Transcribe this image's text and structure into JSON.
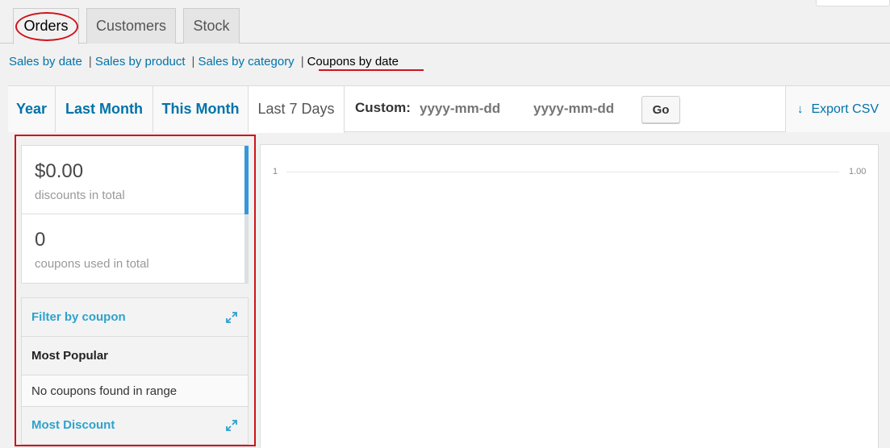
{
  "tabs": [
    {
      "label": "Orders",
      "active": true
    },
    {
      "label": "Customers",
      "active": false
    },
    {
      "label": "Stock",
      "active": false
    }
  ],
  "sublinks": {
    "sales_by_date": "Sales by date",
    "sales_by_product": "Sales by product",
    "sales_by_category": "Sales by category",
    "coupons_by_date": "Coupons by date",
    "separator": "|"
  },
  "range": {
    "year": "Year",
    "last_month": "Last Month",
    "this_month": "This Month",
    "last_7_days": "Last 7 Days",
    "active": "Last 7 Days",
    "custom_label": "Custom:",
    "date_from_placeholder": "yyyy-mm-dd",
    "date_to_placeholder": "yyyy-mm-dd",
    "go_label": "Go",
    "export_label": "Export CSV"
  },
  "summary": [
    {
      "value": "$0.00",
      "label": "discounts in total"
    },
    {
      "value": "0",
      "label": "coupons used in total"
    }
  ],
  "widgets": {
    "filter_by_coupon": "Filter by coupon",
    "most_popular": "Most Popular",
    "no_coupons": "No coupons found in range",
    "most_discount": "Most Discount"
  },
  "chart": {
    "left_axis_label": "1",
    "right_axis_label": "1.00"
  },
  "colors": {
    "accent": "#0073aa",
    "widget_link": "#2ea2cc",
    "annotation": "#d0121b",
    "summary_strip": "#3498db"
  },
  "icons": {
    "export": "download-arrow-icon",
    "expand": "expand-icon"
  }
}
